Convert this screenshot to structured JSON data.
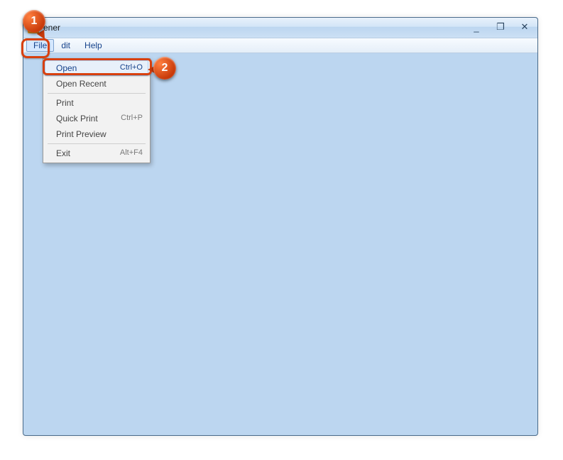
{
  "window": {
    "title": "ener"
  },
  "menubar": {
    "items": [
      {
        "label": "File"
      },
      {
        "label": "dit"
      },
      {
        "label": "Help"
      }
    ]
  },
  "file_menu": {
    "items": [
      {
        "label": "Open",
        "shortcut": "Ctrl+O",
        "highlighted": true
      },
      {
        "label": "Open Recent",
        "shortcut": ""
      },
      {
        "label": "Print",
        "shortcut": ""
      },
      {
        "label": "Quick Print",
        "shortcut": "Ctrl+P"
      },
      {
        "label": "Print Preview",
        "shortcut": ""
      },
      {
        "label": "Exit",
        "shortcut": "Alt+F4"
      }
    ]
  },
  "callouts": {
    "one": "1",
    "two": "2"
  },
  "win_controls": {
    "minimize": "_",
    "maximize": "❐",
    "close": "✕"
  }
}
